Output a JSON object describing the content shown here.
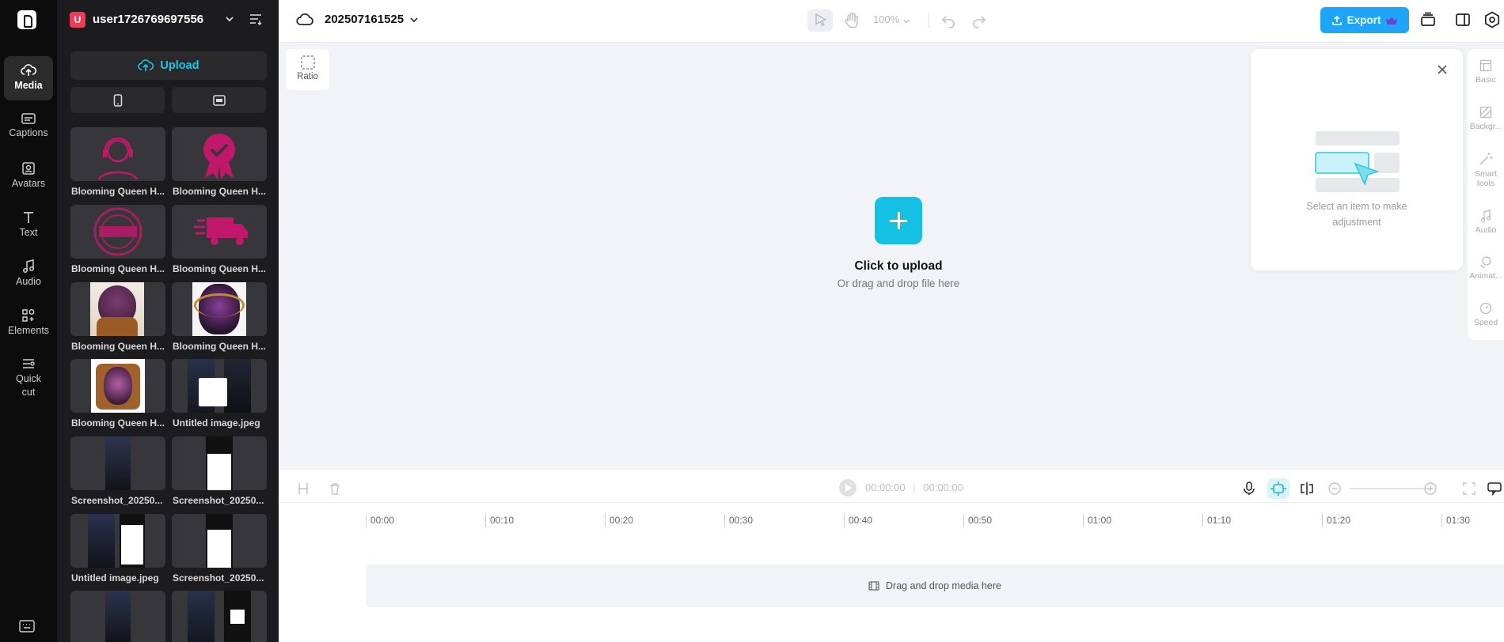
{
  "rail": {
    "items": [
      {
        "label": "Media"
      },
      {
        "label": "Captions"
      },
      {
        "label": "Avatars"
      },
      {
        "label": "Text"
      },
      {
        "label": "Audio"
      },
      {
        "label": "Elements"
      },
      {
        "label": "Quick cut"
      }
    ]
  },
  "panel": {
    "user_initial": "U",
    "username": "user1726769697556",
    "upload_label": "Upload",
    "media": [
      {
        "label": "Blooming Queen H..."
      },
      {
        "label": "Blooming Queen H..."
      },
      {
        "label": "Blooming Queen H..."
      },
      {
        "label": "Blooming Queen H..."
      },
      {
        "label": "Blooming Queen H..."
      },
      {
        "label": "Blooming Queen H..."
      },
      {
        "label": "Blooming Queen H..."
      },
      {
        "label": "Untitled image.jpeg"
      },
      {
        "label": "Screenshot_20250..."
      },
      {
        "label": "Screenshot_20250..."
      },
      {
        "label": "Untitled image.jpeg"
      },
      {
        "label": "Screenshot_20250..."
      },
      {
        "label": ""
      },
      {
        "label": ""
      }
    ]
  },
  "topbar": {
    "project_title": "202507161525",
    "zoom": "100%",
    "export_label": "Export"
  },
  "canvas": {
    "ratio_label": "Ratio",
    "upload_title": "Click to upload",
    "upload_sub": "Or drag and drop file here"
  },
  "popover": {
    "text": "Select an item to make adjustment"
  },
  "props": [
    {
      "label": "Basic"
    },
    {
      "label": "Backgr..."
    },
    {
      "label": "Smart tools"
    },
    {
      "label": "Audio"
    },
    {
      "label": "Animat..."
    },
    {
      "label": "Speed"
    }
  ],
  "timeline": {
    "current": "00:00:00",
    "total": "00:00:00",
    "ticks": [
      "00:00",
      "00:10",
      "00:20",
      "00:30",
      "00:40",
      "00:50",
      "01:00",
      "01:10",
      "01:20",
      "01:30"
    ],
    "drop_label": "Drag and drop media here"
  },
  "colors": {
    "accent": "#15c1e2",
    "export": "#1ea5f8",
    "magenta": "#c2186b"
  }
}
